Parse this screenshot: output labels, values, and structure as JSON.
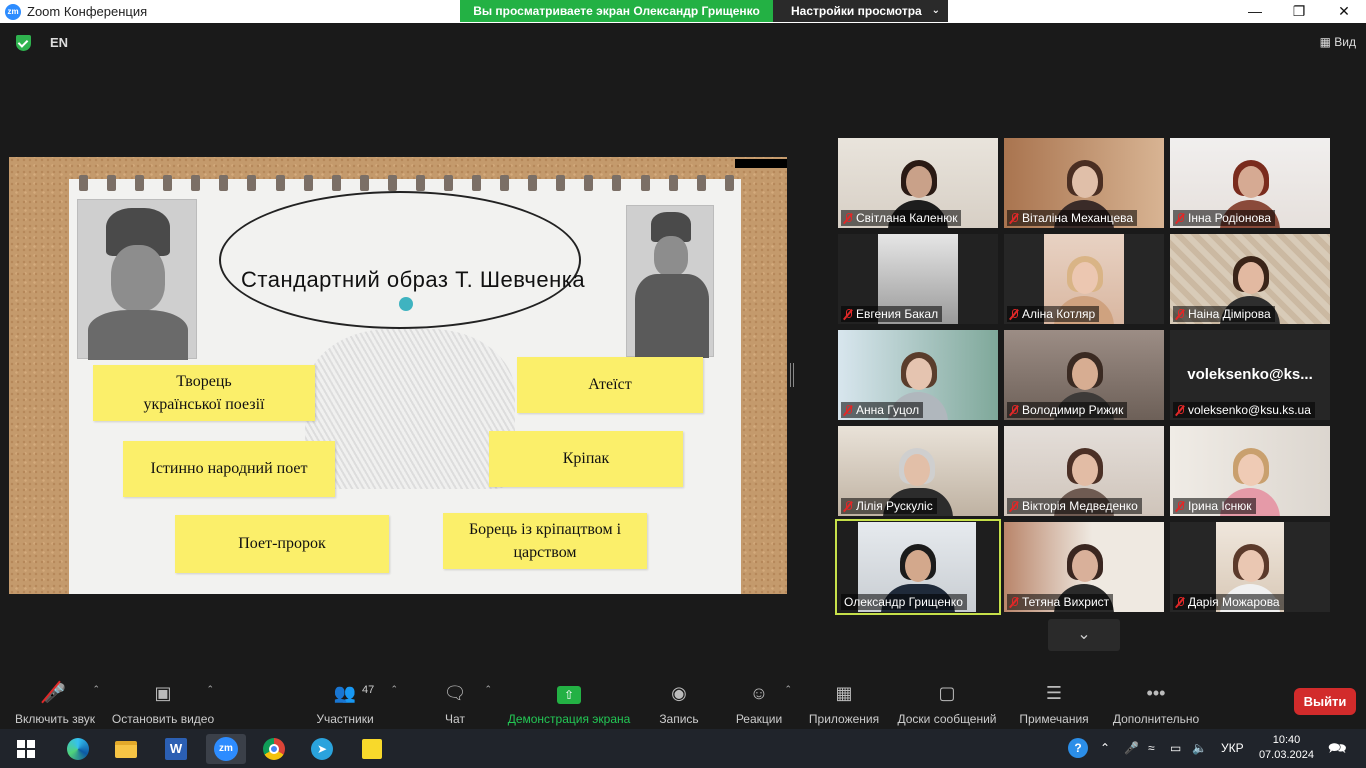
{
  "window": {
    "title": "Zoom Конференция",
    "share_banner": "Вы просматриваете экран Олександр Грищенко",
    "view_options": "Настройки просмотра"
  },
  "top_strip": {
    "language": "EN",
    "view_label": "Вид"
  },
  "slide": {
    "title": "Стандартний образ Т. Шевченка",
    "notes": [
      "Творець\nукраїнської поезії",
      "Істинно народний поет",
      "Поет-пророк",
      "Атеїст",
      "Кріпак",
      "Борець із кріпацтвом і\nцарством"
    ]
  },
  "participants": [
    {
      "name": "Світлана Каленюк",
      "muted": true
    },
    {
      "name": "Віталіна Механцева",
      "muted": true
    },
    {
      "name": "Інна Родіонова",
      "muted": true
    },
    {
      "name": "Евгения Бакал",
      "muted": true
    },
    {
      "name": "Аліна Котляр",
      "muted": true
    },
    {
      "name": "Наіна Дімірова",
      "muted": true
    },
    {
      "name": "Анна Гуцол",
      "muted": true
    },
    {
      "name": "Володимир Рижик",
      "muted": true
    },
    {
      "name": "voleksenko@ksu.ks.ua",
      "muted": true,
      "display_name": "voleksenko@ks..."
    },
    {
      "name": "Лілія Рускуліс",
      "muted": true
    },
    {
      "name": "Вікторія Медведенко",
      "muted": true
    },
    {
      "name": "Ірина Існюк",
      "muted": true
    },
    {
      "name": "Олександр Грищенко",
      "muted": false,
      "active_speaker": true
    },
    {
      "name": "Тетяна Вихрист",
      "muted": true
    },
    {
      "name": "Дарія Можарова",
      "muted": true
    }
  ],
  "toolbar": {
    "unmute": "Включить звук",
    "stop_video": "Остановить видео",
    "participants": "Участники",
    "participants_count": "47",
    "chat": "Чат",
    "share": "Демонстрация экрана",
    "record": "Запись",
    "reactions": "Реакции",
    "apps": "Приложения",
    "whiteboards": "Доски сообщений",
    "notes": "Примечания",
    "more": "Дополнительно",
    "leave": "Выйти"
  },
  "taskbar": {
    "language": "УКР",
    "time": "10:40",
    "date": "07.03.2024"
  },
  "colors": {
    "share_green": "#23b144",
    "leave_red": "#d22b2b",
    "note_yellow": "#fbef6a",
    "active_speaker": "#c6e04a"
  }
}
